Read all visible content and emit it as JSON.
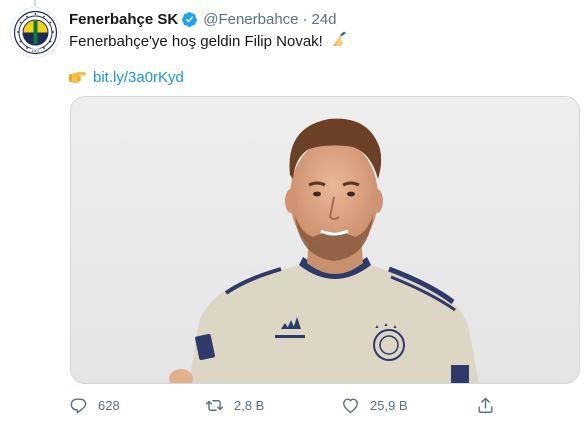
{
  "tweet": {
    "display_name": "Fenerbahçe SK",
    "handle": "@Fenerbahce",
    "separator": "·",
    "time": "24d",
    "text": "Fenerbahçe'ye hoş geldin Filip Novak!",
    "link": "bit.ly/3a0rKyd"
  },
  "actions": {
    "reply_count": "628",
    "retweet_count": "2,8 B",
    "like_count": "25,9 B"
  },
  "icons": {
    "verified": "verified-badge-icon",
    "writing_hand": "writing-hand-emoji",
    "point_right": "pointing-right-emoji",
    "reply": "reply-icon",
    "retweet": "retweet-icon",
    "like": "heart-icon",
    "share": "share-icon"
  },
  "colors": {
    "verified_blue": "#1da1f2",
    "link_blue": "#1b95e0",
    "muted_text": "#5b7083",
    "club_navy": "#1d2b5a",
    "club_yellow": "#f7d117"
  },
  "avatar_lettering": "FENERBAHÇE SPOR KULÜBÜ 1907"
}
